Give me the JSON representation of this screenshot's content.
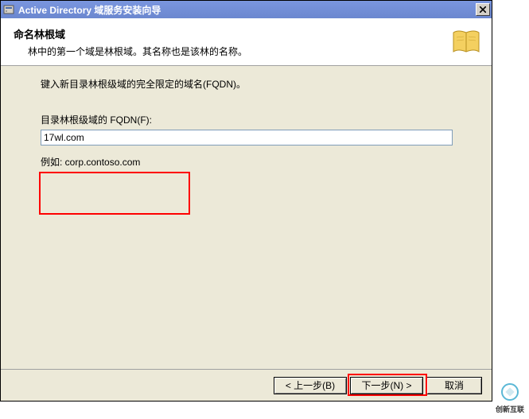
{
  "titlebar": {
    "text": "Active Directory 域服务安装向导"
  },
  "header": {
    "title": "命名林根域",
    "subtitle": "林中的第一个域是林根域。其名称也是该林的名称。"
  },
  "body": {
    "instruction": "键入新目录林根级域的完全限定的域名(FQDN)。",
    "field_label": "目录林根级域的 FQDN(F):",
    "fqdn_value": "17wl.com",
    "example": "例如: corp.contoso.com"
  },
  "buttons": {
    "back": "< 上一步(B)",
    "next": "下一步(N) >",
    "cancel": "取消"
  },
  "watermark": {
    "brand": "创新互联"
  }
}
